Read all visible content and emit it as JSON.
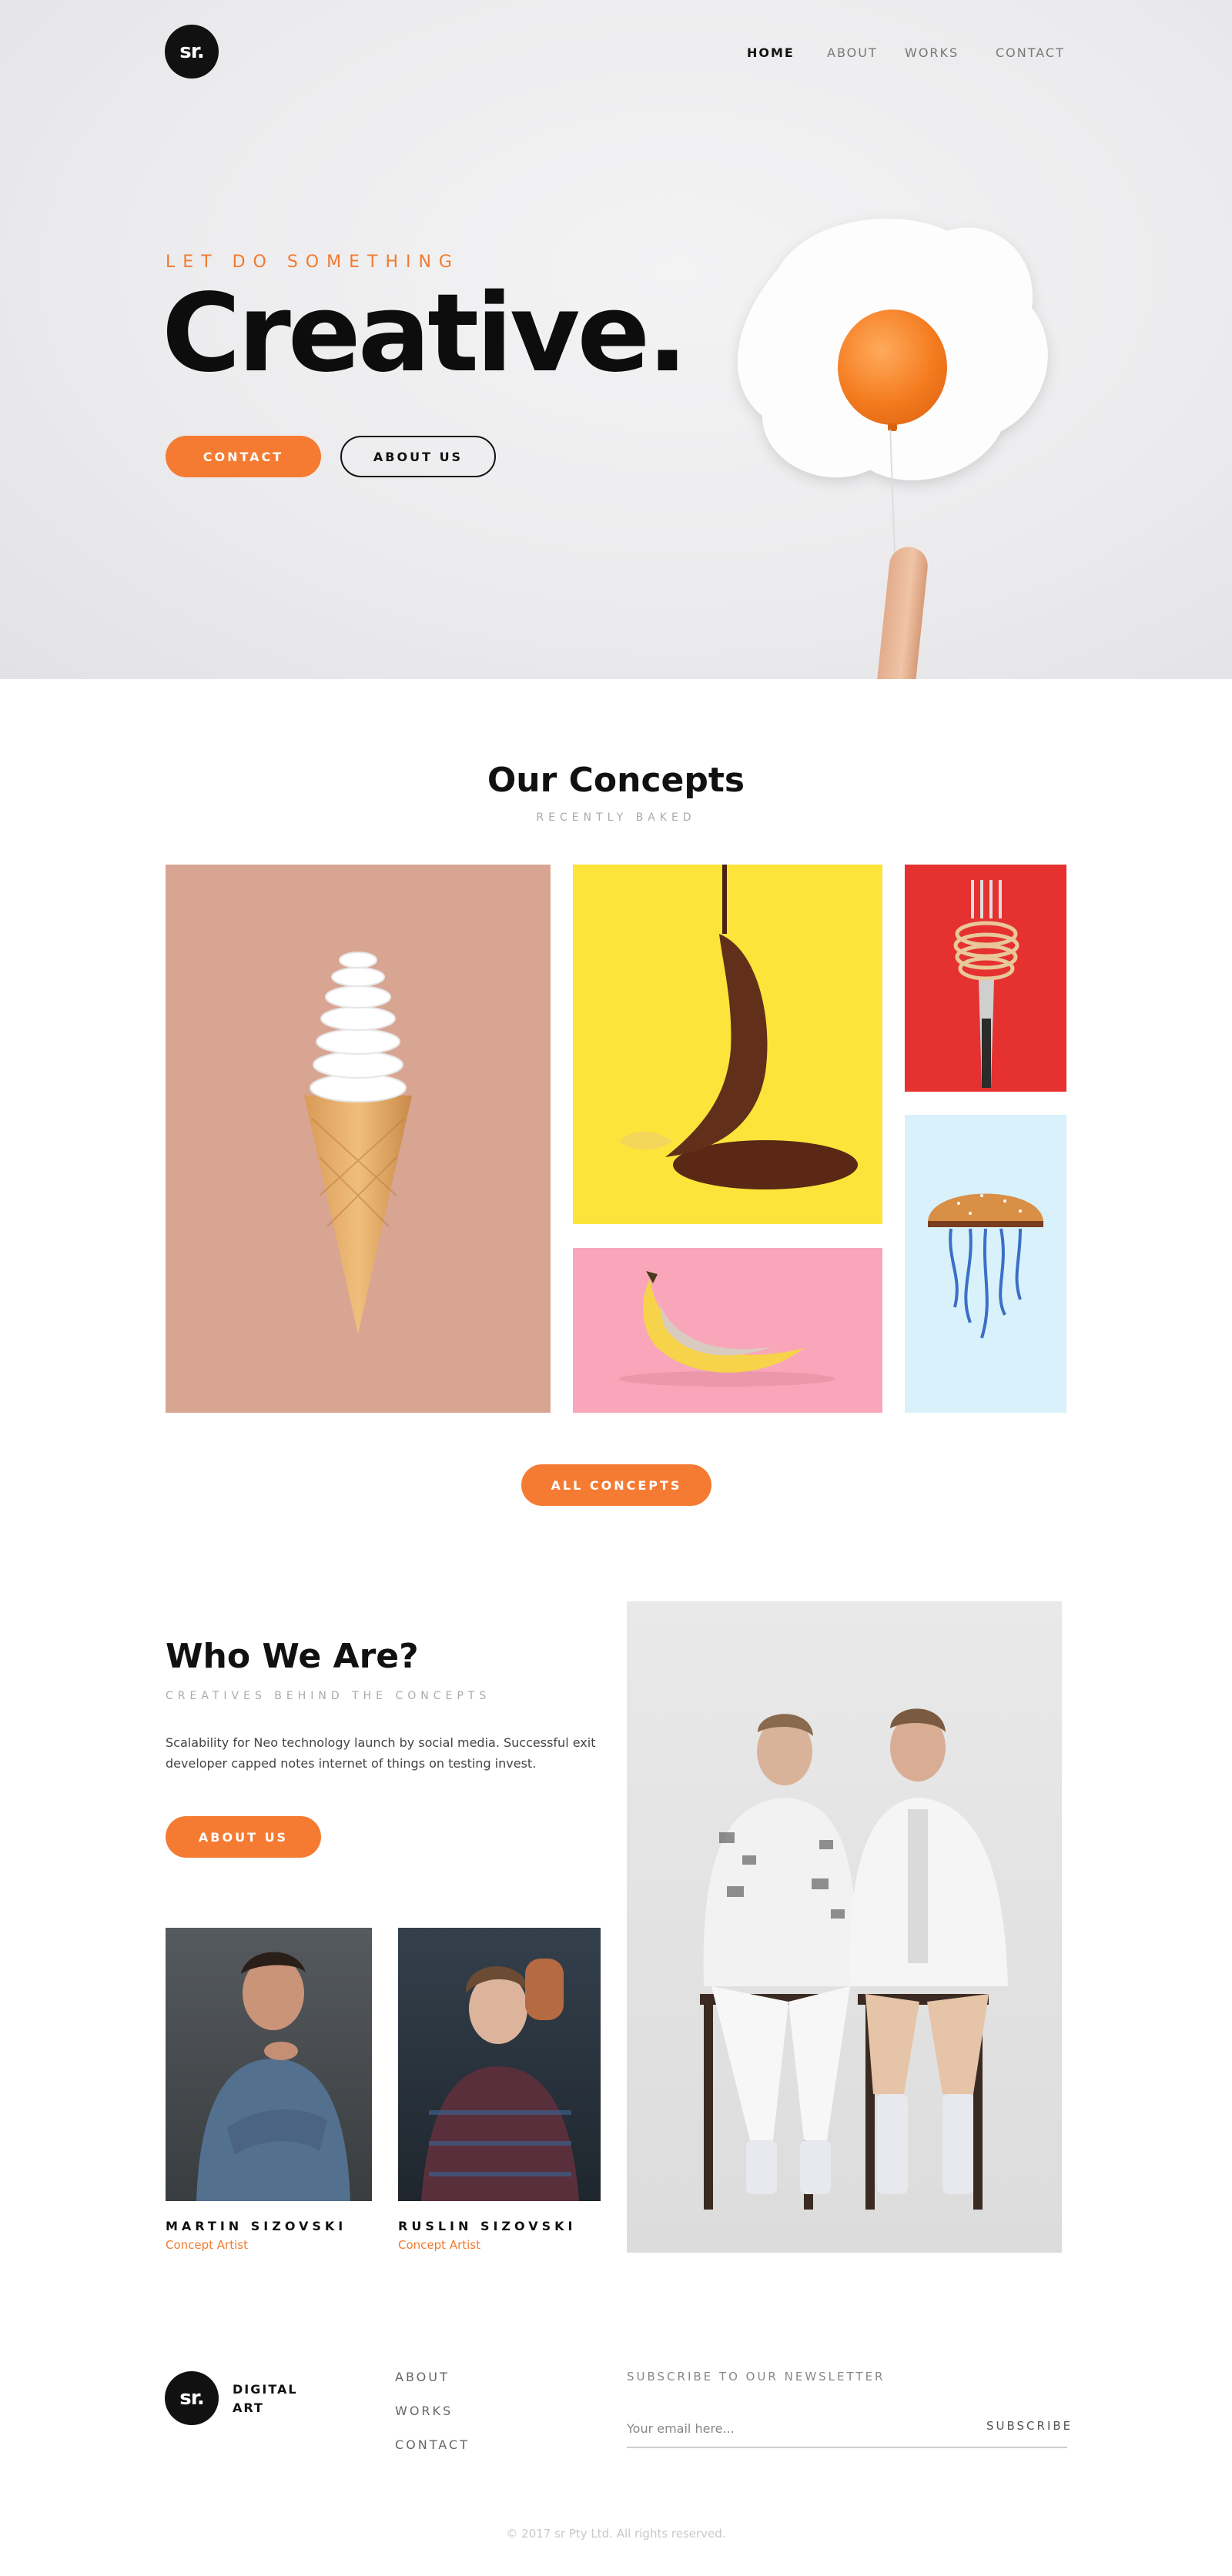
{
  "brand": {
    "logo_text": "sr.",
    "footer_name_line1": "DIGITAL",
    "footer_name_line2": "ART"
  },
  "nav": {
    "items": [
      {
        "label": "HOME"
      },
      {
        "label": "ABOUT"
      },
      {
        "label": "WORKS"
      },
      {
        "label": "CONTACT"
      }
    ],
    "active": "HOME"
  },
  "hero": {
    "kicker": "LET DO SOMETHING",
    "title": "Creative.",
    "primary_button": "CONTACT",
    "secondary_button": "ABOUT US"
  },
  "concepts": {
    "title": "Our Concepts",
    "subtitle": "RECENTLY BAKED",
    "button": "ALL CONCEPTS"
  },
  "about": {
    "title": "Who We Are?",
    "subtitle": "CREATIVES BEHIND THE CONCEPTS",
    "body_line1": "Scalability for Neo technology launch by social media. Successful exit",
    "body_line2": "developer capped notes internet of things on testing invest.",
    "button": "ABOUT US",
    "members": [
      {
        "name": "MARTIN SIZOVSKI",
        "role": "Concept Artist"
      },
      {
        "name": "RUSLIN SIZOVSKI",
        "role": "Concept Artist"
      }
    ]
  },
  "footer": {
    "links": [
      {
        "label": "ABOUT"
      },
      {
        "label": "WORKS"
      },
      {
        "label": "CONTACT"
      }
    ],
    "newsletter_title": "SUBSCRIBE TO OUR NEWSLETTER",
    "email_placeholder": "Your email here...",
    "subscribe_label": "SUBSCRIBE",
    "copyright": "© 2017 sr Pty Ltd. All rights reserved."
  },
  "colors": {
    "accent": "#f57b33",
    "dark": "#111111"
  }
}
